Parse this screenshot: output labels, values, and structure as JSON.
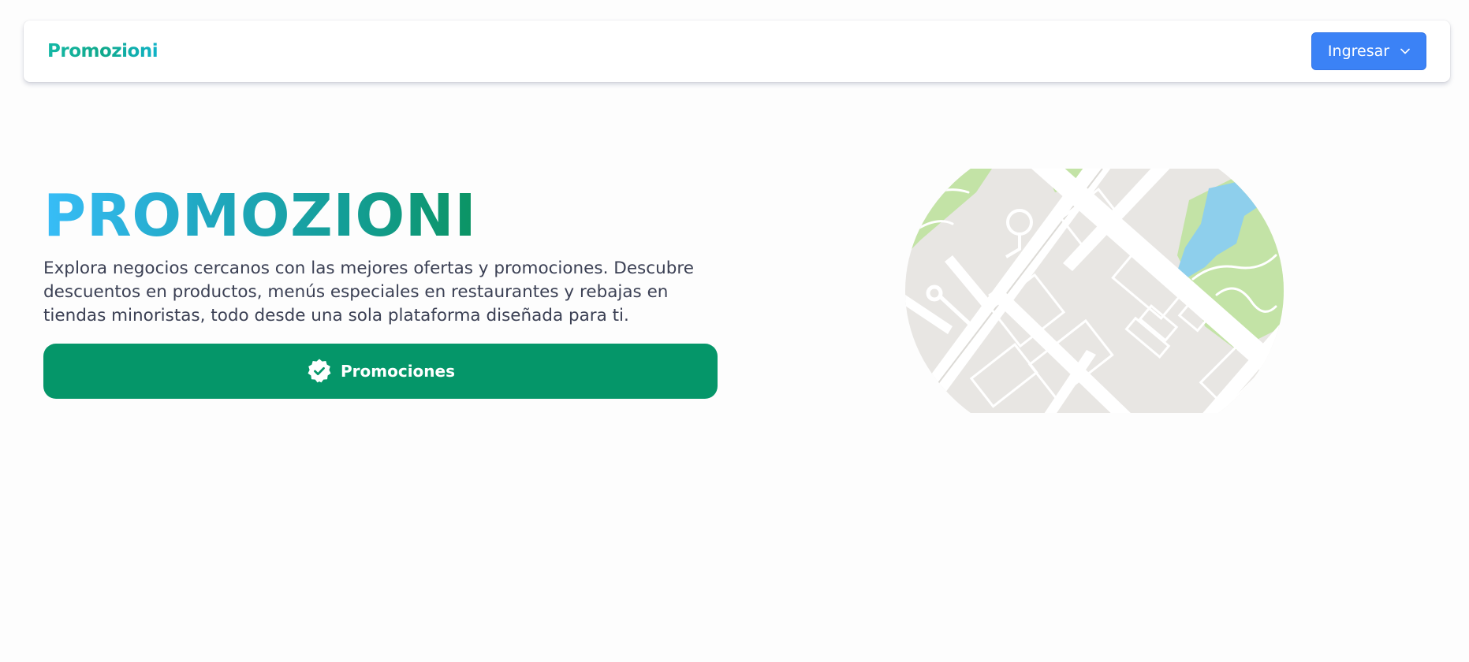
{
  "navbar": {
    "brand": "Promozioni",
    "login_label": "Ingresar",
    "login_icon": "chevron-down-icon"
  },
  "hero": {
    "title": "PROMOZIONI",
    "description": "Explora negocios cercanos con las mejores ofertas y promociones. Descubre descuentos en productos, menús especiales en restaurantes y rebajas en tiendas minoristas, todo desde una sola plataforma diseñada para ti.",
    "cta_label": "Promociones",
    "cta_icon": "verified-badge-icon"
  },
  "colors": {
    "background": "#fdfdfd",
    "login_button": "#3b82f6",
    "cta_button": "#059669",
    "title_gradient_start": "#38bdf8",
    "title_gradient_end": "#0b9463",
    "text": "#3b4054",
    "map_land": "#e8e6e3",
    "map_park": "#c3e3a6",
    "map_water": "#8ecfec"
  },
  "map": {
    "icon": "city-map-illustration"
  }
}
